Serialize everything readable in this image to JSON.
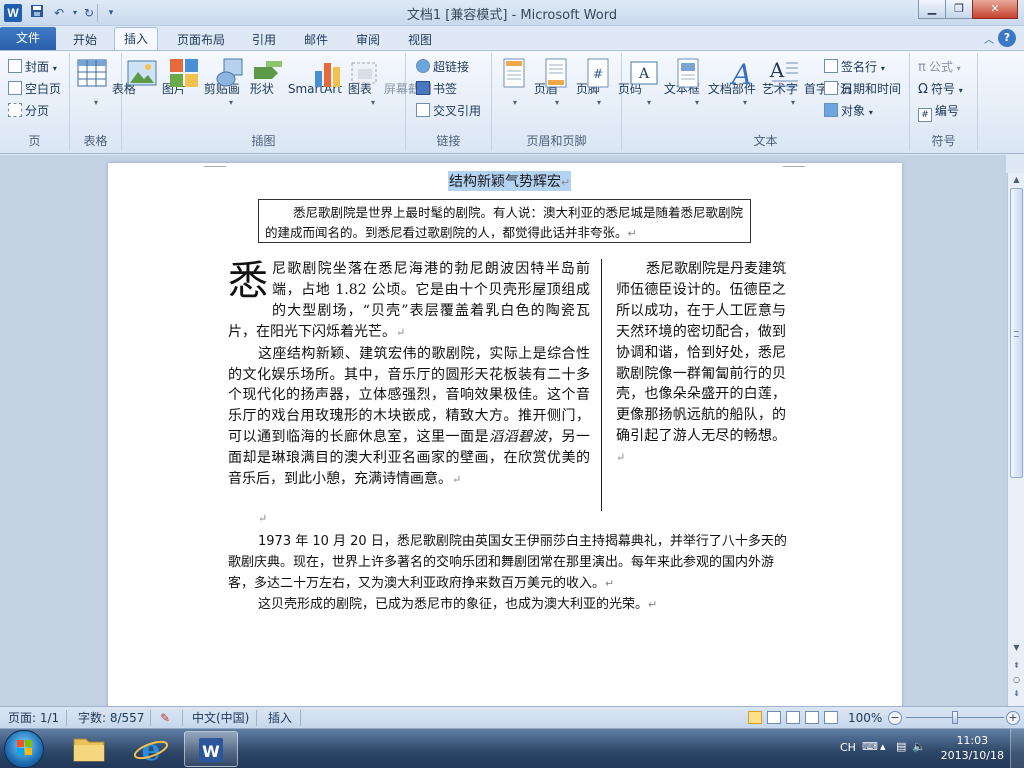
{
  "window": {
    "title": "文档1 [兼容模式] - Microsoft Word",
    "app_icon_label": "W"
  },
  "tabs": {
    "file": "文件",
    "items": [
      "开始",
      "插入",
      "页面布局",
      "引用",
      "邮件",
      "审阅",
      "视图"
    ],
    "active": "插入"
  },
  "ribbon": {
    "pages_group": {
      "label": "页",
      "cover": "封面",
      "blank": "空白页",
      "break": "分页"
    },
    "table_group": {
      "label": "表格",
      "table": "表格"
    },
    "illustrations_group": {
      "label": "插图",
      "picture": "图片",
      "clipart": "剪贴画",
      "shapes": "形状",
      "smartart": "SmartArt",
      "chart": "图表",
      "screenshot": "屏幕截图"
    },
    "links_group": {
      "label": "链接",
      "hyperlink": "超链接",
      "bookmark": "书签",
      "crossref": "交叉引用"
    },
    "header_footer_group": {
      "label": "页眉和页脚",
      "header": "页眉",
      "footer": "页脚",
      "page_number": "页码"
    },
    "text_group": {
      "label": "文本",
      "textbox": "文本框",
      "quickparts": "文档部件",
      "wordart": "艺术字",
      "dropcap": "首字下沉",
      "signature": "签名行",
      "datetime": "日期和时间",
      "object": "对象"
    },
    "symbols_group": {
      "label": "符号",
      "equation": "公式",
      "symbol": "符号",
      "number": "编号"
    }
  },
  "document": {
    "title": "结构新颖气势辉宏",
    "intro": "悉尼歌剧院是世界上最时髦的剧院。有人说：澳大利亚的悉尼城是随着悉尼歌剧院的建成而闻名的。到悉尼看过歌剧院的人，都觉得此话并非夸张。",
    "dropcap": "悉",
    "left_p1": "尼歌剧院坐落在悉尼海港的勃尼朗波因特半岛前端，占地 1.82 公顷。它是由十个贝壳形屋顶组成的大型剧场，“贝壳”表层覆盖着乳白色的陶瓷瓦片，在阳光下闪烁着光芒。",
    "left_p2_a": "这座结构新颖、建筑宏伟的歌剧院，实际上是综合性的文化娱乐场所。其中，音乐厅的圆形天花板装有二十多个现代化的扬声器，立体感强烈，音响效果极佳。这个音乐厅的戏台用玫瑰形的木块嵌成，精致大方。推开侧门，可以通到临海的长廊休息室，这里一面是",
    "left_p2_ital": "滔滔碧波",
    "left_p2_b": "，另一面却是琳琅满目的澳大利亚名画家的壁画，在欣赏优美的音乐后，到此小憩，充满诗情画意。",
    "right_p": "悉尼歌剧院是丹麦建筑师伍德臣设计的。伍德臣之所以成功，在于人工匠意与天然环境的密切配合，做到协调和谐，恰到好处，悉尼歌剧院像一群匍匐前行的贝壳，也像朵朵盛开的白莲，更像那扬帆远航的船队，的确引起了游人无尽的畅想。",
    "body_p1": "1973 年 10 月 20 日，悉尼歌剧院由英国女王伊丽莎白主持揭幕典礼，并举行了八十多天的歌剧庆典。现在，世界上许多著名的交响乐团和舞剧团常在那里演出。每年来此参观的国内外游客，多达二十万左右，又为澳大利亚政府挣来数百万美元的收入。",
    "body_p2": "这贝壳形成的剧院，已成为悉尼市的象征，也成为澳大利亚的光荣。",
    "para_mark": "↵"
  },
  "status": {
    "page": "页面: 1/1",
    "words": "字数: 8/557",
    "language": "中文(中国)",
    "mode": "插入",
    "zoom": "100%",
    "zoom_percent": 100
  },
  "taskbar": {
    "ime": "CH",
    "time": "11:03",
    "date": "2013/10/18"
  },
  "colors": {
    "accent": "#2b579a",
    "file_tab": "#2a5fa8",
    "selection": "#b3d3f3"
  }
}
